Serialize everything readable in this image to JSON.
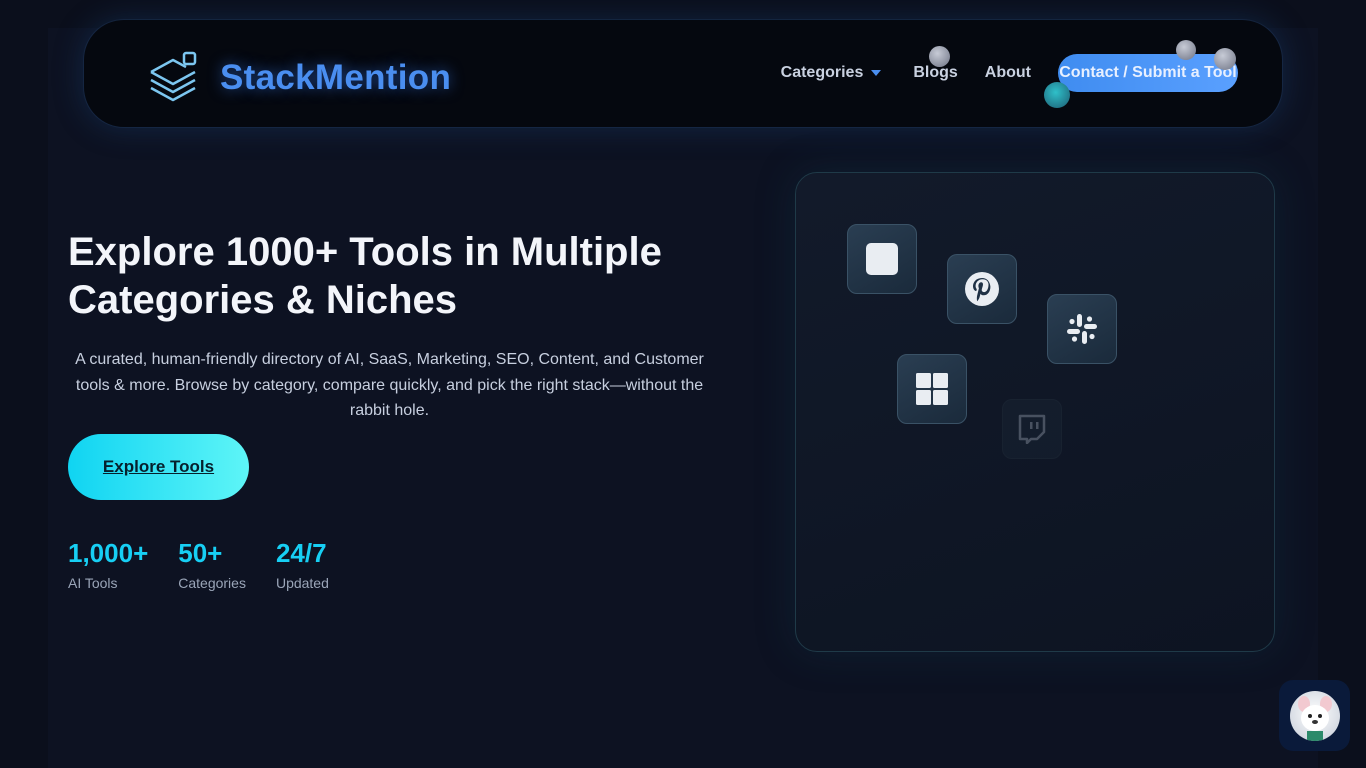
{
  "brand": {
    "name": "StackMention"
  },
  "nav": {
    "categories": "Categories",
    "blogs": "Blogs",
    "about": "About",
    "cta": "Contact / Submit a Tool"
  },
  "hero": {
    "title": "Explore 1000+ Tools in Multiple Categories & Niches",
    "description": "A curated, human-friendly directory of AI, SaaS, Marketing, SEO, Content, and Customer tools & more. Browse by category, compare quickly, and pick the right stack—without the rabbit hole.",
    "button": "Explore Tools"
  },
  "stats": [
    {
      "value": "1,000+",
      "label": "AI Tools"
    },
    {
      "value": "50+",
      "label": "Categories"
    },
    {
      "value": "24/7",
      "label": "Updated"
    }
  ],
  "showcase": {
    "icons": [
      "app-icon",
      "pinterest-icon",
      "slack-icon",
      "windows-icon",
      "twitch-icon"
    ]
  },
  "colors": {
    "accent": "#4a8ef0",
    "cyan": "#17cff4",
    "background": "#0d1222"
  }
}
